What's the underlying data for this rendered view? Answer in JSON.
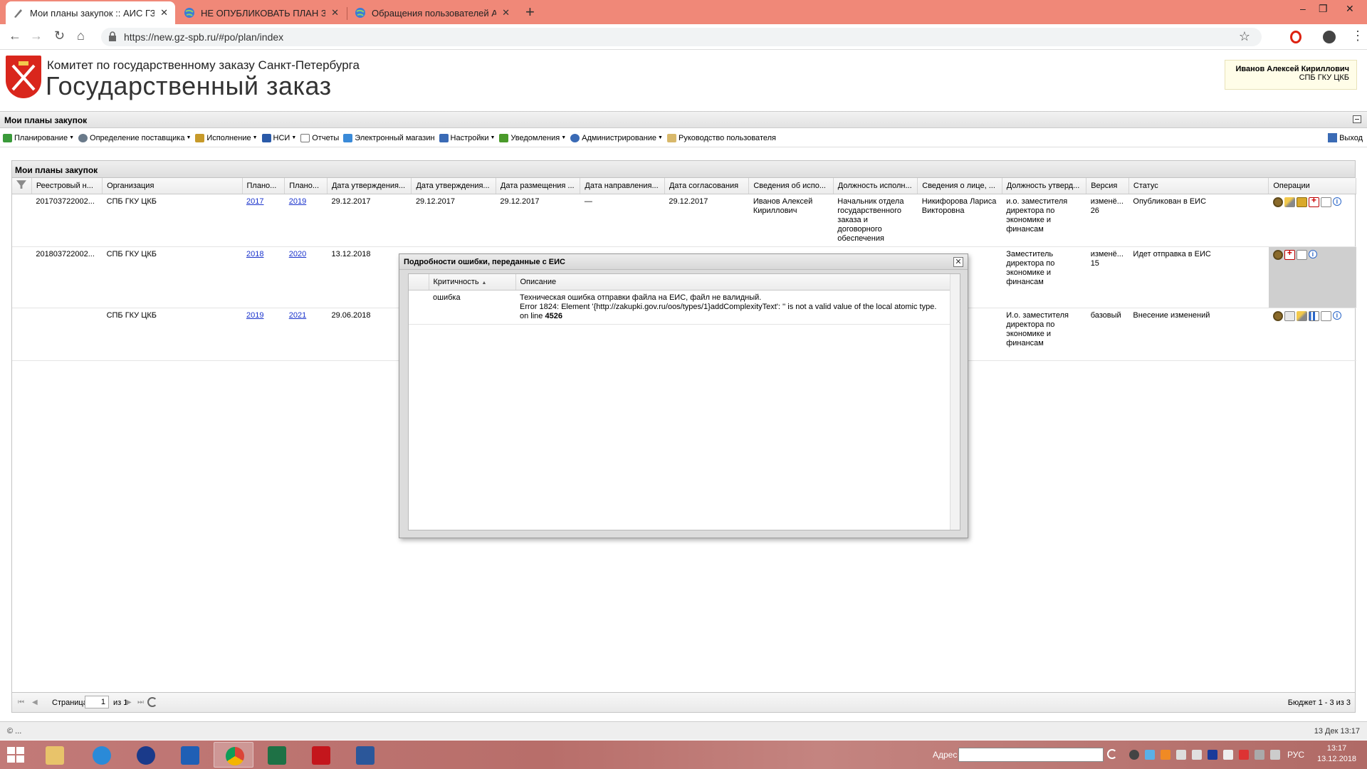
{
  "browser": {
    "tabs": [
      {
        "title": "Мои планы закупок :: АИС ГЗ",
        "close": "✕"
      },
      {
        "title": "НЕ ОПУБЛИКОВАТЬ ПЛАН ЗАК",
        "close": "✕"
      },
      {
        "title": "Обращения пользователей АИ",
        "close": "✕"
      }
    ],
    "new_tab": "+",
    "url": "https://new.gz-spb.ru/#po/plan/index",
    "window_controls": [
      "–",
      "❐",
      "✕"
    ]
  },
  "header": {
    "org_name": "Комитет по государственному заказу Санкт-Петербурга",
    "app_name": "Государственный заказ",
    "user_name": "Иванов Алексей Кириллович",
    "user_org": "СПБ ГКУ ЦКБ"
  },
  "page_title": "Мои планы закупок",
  "menu": {
    "items": [
      {
        "label": "Планирование",
        "color": "#3a9a3a",
        "dropdown": true
      },
      {
        "label": "Определение поставщика",
        "color": "#6a7a8a",
        "dropdown": true
      },
      {
        "label": "Исполнение",
        "color": "#c79a2a",
        "dropdown": true
      },
      {
        "label": "НСИ",
        "color": "#2a5aa8",
        "dropdown": true
      },
      {
        "label": "Отчеты",
        "color": "#e0e0e0",
        "dropdown": false
      },
      {
        "label": "Электронный магазин",
        "color": "#3a8ad8",
        "dropdown": false
      },
      {
        "label": "Настройки",
        "color": "#3a6ab5",
        "dropdown": true
      },
      {
        "label": "Уведомления",
        "color": "#4a9a2a",
        "dropdown": true
      },
      {
        "label": "Администрирование",
        "color": "#3a6ab5",
        "dropdown": true
      },
      {
        "label": "Руководство пользователя",
        "color": "#d8b86a",
        "dropdown": false
      }
    ],
    "exit_label": "Выход"
  },
  "grid": {
    "title": "Мои планы закупок",
    "columns": [
      "",
      "Реестровый н...",
      "Организация",
      "Плано...",
      "Плано...",
      "Дата утверждения...",
      "Дата утверждения...",
      "Дата размещения ...",
      "Дата направления...",
      "Дата согласования",
      "Сведения об испо...",
      "Должность исполн...",
      "Сведения о лице, ...",
      "Должность утверд...",
      "Версия",
      "Статус",
      "Операции"
    ],
    "rows": [
      {
        "reg": "201703722002...",
        "org": "СПБ ГКУ ЦКБ",
        "year_from": "2017",
        "year_to": "2019",
        "d1": "29.12.2017",
        "d2": "29.12.2017",
        "d3": "29.12.2017",
        "d4": "—",
        "d5": "29.12.2017",
        "executor": "Иванов Алексей Кириллович",
        "exec_pos": "Начальник отдела государственного заказа и договорного обеспечения",
        "approver": "Никифорова Лариса Викторовна",
        "appr_pos": "и.о. заместителя директора по экономике и финансам",
        "version": "изменё... 26",
        "status": "Опубликован в ЕИС"
      },
      {
        "reg": "201803722002...",
        "org": "СПБ ГКУ ЦКБ",
        "year_from": "2018",
        "year_to": "2020",
        "d1": "13.12.2018",
        "d2": "",
        "d3": "",
        "d4": "",
        "d5": "",
        "executor": "",
        "exec_pos": "",
        "approver": "",
        "appr_pos": "Заместитель директора по экономике и финансам",
        "version": "изменё... 15",
        "status": "Идет отправка в ЕИС"
      },
      {
        "reg": "",
        "org": "СПБ ГКУ ЦКБ",
        "year_from": "2019",
        "year_to": "2021",
        "d1": "29.06.2018",
        "d2": "",
        "d3": "",
        "d4": "",
        "d5": "",
        "executor": "",
        "exec_pos": "",
        "approver": "",
        "appr_pos": "И.о. заместителя директора по экономике и финансам",
        "version": "базовый",
        "status": "Внесение изменений"
      }
    ]
  },
  "pager": {
    "page_label": "Страница",
    "page_value": "1",
    "of_label": "из 1",
    "info": "Бюджет 1 - 3 из 3"
  },
  "status_bar": {
    "left": "© ...",
    "right": "13 Дек 13:17"
  },
  "modal": {
    "title": "Подробности ошибки, переданные с ЕИС",
    "close": "✕",
    "col_severity": "Критичность",
    "col_description": "Описание",
    "rows": [
      {
        "severity": "ошибка",
        "line1": "Техническая ошибка отправки файла на ЕИС, файл не валидный.",
        "line2": "Error 1824: Element '{http://zakupki.gov.ru/oos/types/1}addComplexityText': '' is not a valid value of the local atomic type.",
        "line3_prefix": "on line",
        "line3_number": "4526"
      }
    ]
  },
  "taskbar": {
    "address_label": "Адрес",
    "language": "РУС",
    "time": "13:17",
    "date": "13.12.2018"
  }
}
